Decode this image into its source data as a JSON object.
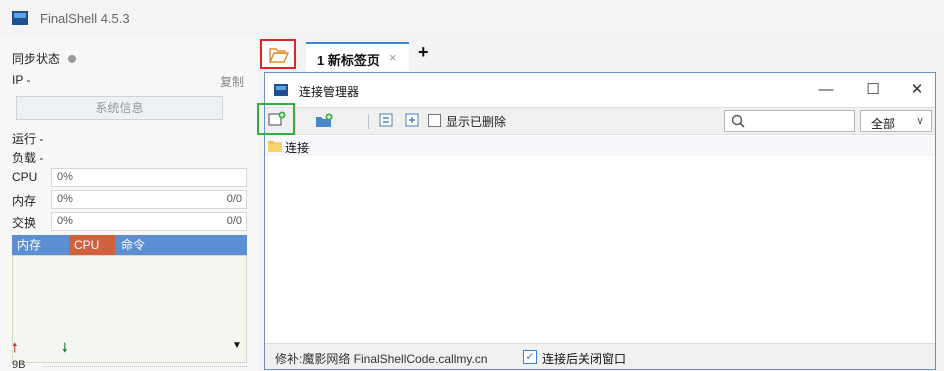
{
  "app": {
    "title": "FinalShell 4.5.3"
  },
  "sidebar": {
    "sync_label": "同步状态",
    "ip_label": "IP  -",
    "copy_label": "复制",
    "sysinfo_label": "系统信息",
    "run_label": "运行 -",
    "load_label": "负载 -",
    "meters": [
      {
        "label": "CPU",
        "value": "0%",
        "right": ""
      },
      {
        "label": "内存",
        "value": "0%",
        "right": "0/0"
      },
      {
        "label": "交换",
        "value": "0%",
        "right": "0/0"
      }
    ],
    "process_tabs": [
      "内存",
      "CPU",
      "命令"
    ],
    "net": {
      "up_icon": "arrow-up-icon",
      "down_icon": "arrow-down-icon",
      "menu_icon": "triangle-down-icon",
      "value": "9B"
    }
  },
  "tabs": {
    "open_folder_icon": "folder-open-icon",
    "items": [
      {
        "label": "1 新标签页",
        "close": "×"
      }
    ],
    "add": "+"
  },
  "conn_manager": {
    "title": "连接管理器",
    "window_buttons": {
      "minimize": "—",
      "maximize": "☐",
      "close": "✕"
    },
    "toolbar": {
      "new_connection_icon": "new-connection-icon",
      "new_folder_icon": "new-folder-icon",
      "collapse_icon": "collapse-all-icon",
      "expand_icon": "expand-all-icon",
      "show_deleted_label": "显示已删除",
      "show_deleted_checked": false,
      "search_value": "",
      "filter_value": "全部"
    },
    "tree": [
      {
        "label": "连接",
        "icon": "folder-icon"
      }
    ],
    "status_note": "修补:魔影网络 FinalShellCode.callmy.cn",
    "close_after_connect_label": "连接后关闭窗口",
    "close_after_connect_checked": true
  },
  "colors": {
    "accent": "#3b82d6",
    "highlight_red": "#e02424",
    "highlight_green": "#2eb33a",
    "process_header": "#5b8fd1",
    "cpu_tab": "#d1603f"
  }
}
